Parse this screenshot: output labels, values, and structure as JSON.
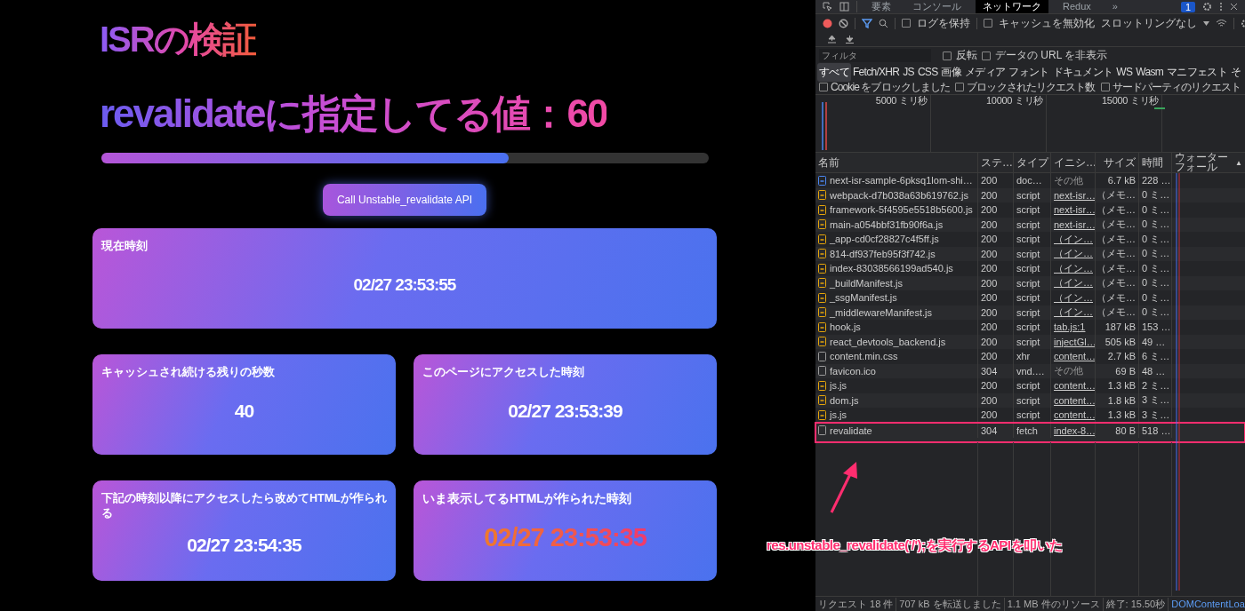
{
  "page": {
    "title": "ISRの検証",
    "subtitle": "revalidateに指定してる値：60",
    "progress": {
      "level": 0.67
    },
    "button": "Call Unstable_revalidate API",
    "cards": [
      {
        "label": "現在時刻",
        "value": "02/27 23:53:55",
        "full_width": true,
        "emphasis": false
      },
      {
        "label": "キャッシュされ続ける残りの秒数",
        "value": "40",
        "full_width": false,
        "emphasis": false
      },
      {
        "label": "このページにアクセスした時刻",
        "value": "02/27 23:53:39",
        "full_width": false,
        "emphasis": false
      },
      {
        "label": "下記の時刻以降にアクセスしたら改めてHTMLが作られる",
        "value": "02/27 23:54:35",
        "full_width": false,
        "emphasis": false
      },
      {
        "label": "いま表示してるHTMLが作られた時刻",
        "value": "02/27 23:53:35",
        "full_width": false,
        "emphasis": true
      }
    ]
  },
  "devtools": {
    "tabs": [
      {
        "label": "要素",
        "selected": false
      },
      {
        "label": "コンソール",
        "selected": false
      },
      {
        "label": "ネットワーク",
        "selected": true
      },
      {
        "label": "Redux",
        "selected": false
      },
      {
        "label": "»",
        "selected": false
      }
    ],
    "badge": "1",
    "toolbar": {
      "preserve_log": {
        "label": "ログを保持",
        "checked": false
      },
      "disable_cache": {
        "label": "キャッシュを無効化",
        "checked": false
      },
      "throttling": "スロットリングなし"
    },
    "filter": {
      "placeholder": "フィルタ",
      "options": [
        {
          "label": "反転",
          "checked": false
        },
        {
          "label": "データの URL を非表示",
          "checked": false
        }
      ]
    },
    "types": [
      {
        "label": "すべて",
        "selected": true
      },
      {
        "label": "Fetch/XHR",
        "selected": false
      },
      {
        "label": "JS",
        "selected": false
      },
      {
        "label": "CSS",
        "selected": false
      },
      {
        "label": "画像",
        "selected": false
      },
      {
        "label": "メディア",
        "selected": false
      },
      {
        "label": "フォント",
        "selected": false
      },
      {
        "label": "ドキュメント",
        "selected": false
      },
      {
        "label": "WS",
        "selected": false
      },
      {
        "label": "Wasm",
        "selected": false
      },
      {
        "label": "マニフェスト",
        "selected": false
      },
      {
        "label": "そ",
        "selected": false
      }
    ],
    "block_options": [
      {
        "label": "Cookie をブロックしました",
        "checked": false
      },
      {
        "label": "ブロックされたリクエスト数",
        "checked": false
      },
      {
        "label": "サードパーティのリクエスト",
        "checked": false
      }
    ],
    "timeline_labels": [
      "5000 ミリ秒",
      "10000 ミリ秒",
      "15000 ミリ秒"
    ],
    "columns": [
      "名前",
      "ステ…",
      "タイプ",
      "イニシ…",
      "サイズ",
      "時間",
      "ウォーターフォール",
      "▲"
    ],
    "rows": [
      {
        "kind": "document",
        "name": "next-isr-sample-6pksq1lom-shi…",
        "status": "200",
        "type": "doc…",
        "initiator": "その他",
        "initiator_link": false,
        "size": "6.7 kB",
        "time": "228 …",
        "highlighted": false
      },
      {
        "kind": "script",
        "name": "webpack-d7b038a63b619762.js",
        "status": "200",
        "type": "script",
        "initiator": "next-isr…",
        "initiator_link": true,
        "size": "（メモ…",
        "time": "0 ミ…",
        "highlighted": false
      },
      {
        "kind": "script",
        "name": "framework-5f4595e5518b5600.js",
        "status": "200",
        "type": "script",
        "initiator": "next-isr…",
        "initiator_link": true,
        "size": "（メモ…",
        "time": "0 ミ…",
        "highlighted": false
      },
      {
        "kind": "script",
        "name": "main-a054bbf31fb90f6a.js",
        "status": "200",
        "type": "script",
        "initiator": "next-isr…",
        "initiator_link": true,
        "size": "（メモ…",
        "time": "0 ミ…",
        "highlighted": false
      },
      {
        "kind": "script",
        "name": "_app-cd0cf28827c4f5ff.js",
        "status": "200",
        "type": "script",
        "initiator": "（イン…",
        "initiator_link": true,
        "size": "（メモ…",
        "time": "0 ミ…",
        "highlighted": false
      },
      {
        "kind": "script",
        "name": "814-df937feb95f3f742.js",
        "status": "200",
        "type": "script",
        "initiator": "（イン…",
        "initiator_link": true,
        "size": "（メモ…",
        "time": "0 ミ…",
        "highlighted": false
      },
      {
        "kind": "script",
        "name": "index-83038566199ad540.js",
        "status": "200",
        "type": "script",
        "initiator": "（イン…",
        "initiator_link": true,
        "size": "（メモ…",
        "time": "0 ミ…",
        "highlighted": false
      },
      {
        "kind": "script",
        "name": "_buildManifest.js",
        "status": "200",
        "type": "script",
        "initiator": "（イン…",
        "initiator_link": true,
        "size": "（メモ…",
        "time": "0 ミ…",
        "highlighted": false
      },
      {
        "kind": "script",
        "name": "_ssgManifest.js",
        "status": "200",
        "type": "script",
        "initiator": "（イン…",
        "initiator_link": true,
        "size": "（メモ…",
        "time": "0 ミ…",
        "highlighted": false
      },
      {
        "kind": "script",
        "name": "_middlewareManifest.js",
        "status": "200",
        "type": "script",
        "initiator": "（イン…",
        "initiator_link": true,
        "size": "（メモ…",
        "time": "0 ミ…",
        "highlighted": false
      },
      {
        "kind": "script",
        "name": "hook.js",
        "status": "200",
        "type": "script",
        "initiator": "tab.js:1",
        "initiator_link": true,
        "size": "187 kB",
        "time": "153 …",
        "highlighted": false
      },
      {
        "kind": "script",
        "name": "react_devtools_backend.js",
        "status": "200",
        "type": "script",
        "initiator": "injectGl…",
        "initiator_link": true,
        "size": "505 kB",
        "time": "49 …",
        "highlighted": false
      },
      {
        "kind": "other",
        "name": "content.min.css",
        "status": "200",
        "type": "xhr",
        "initiator": "content…",
        "initiator_link": true,
        "size": "2.7 kB",
        "time": "6 ミ…",
        "highlighted": false
      },
      {
        "kind": "other",
        "name": "favicon.ico",
        "status": "304",
        "type": "vnd.…",
        "initiator": "その他",
        "initiator_link": false,
        "size": "69 B",
        "time": "48 …",
        "highlighted": false
      },
      {
        "kind": "script",
        "name": "js.js",
        "status": "200",
        "type": "script",
        "initiator": "content…",
        "initiator_link": true,
        "size": "1.3 kB",
        "time": "2 ミ…",
        "highlighted": false
      },
      {
        "kind": "script",
        "name": "dom.js",
        "status": "200",
        "type": "script",
        "initiator": "content…",
        "initiator_link": true,
        "size": "1.8 kB",
        "time": "3 ミ…",
        "highlighted": false
      },
      {
        "kind": "script",
        "name": "js.js",
        "status": "200",
        "type": "script",
        "initiator": "content…",
        "initiator_link": true,
        "size": "1.3 kB",
        "time": "3 ミ…",
        "highlighted": false
      },
      {
        "kind": "other",
        "name": "revalidate",
        "status": "304",
        "type": "fetch",
        "initiator": "index-8…",
        "initiator_link": true,
        "size": "80 B",
        "time": "518 …",
        "highlighted": true
      }
    ],
    "status_bar": [
      "リクエスト 18 件",
      "707 kB を転送しました",
      "1.1 MB 件のリソース",
      "終了: 15.50秒"
    ],
    "status_link": "DOMContentLoa"
  },
  "annotation": "res.unstable_revalidate('/');を実行するAPIを叩いた"
}
